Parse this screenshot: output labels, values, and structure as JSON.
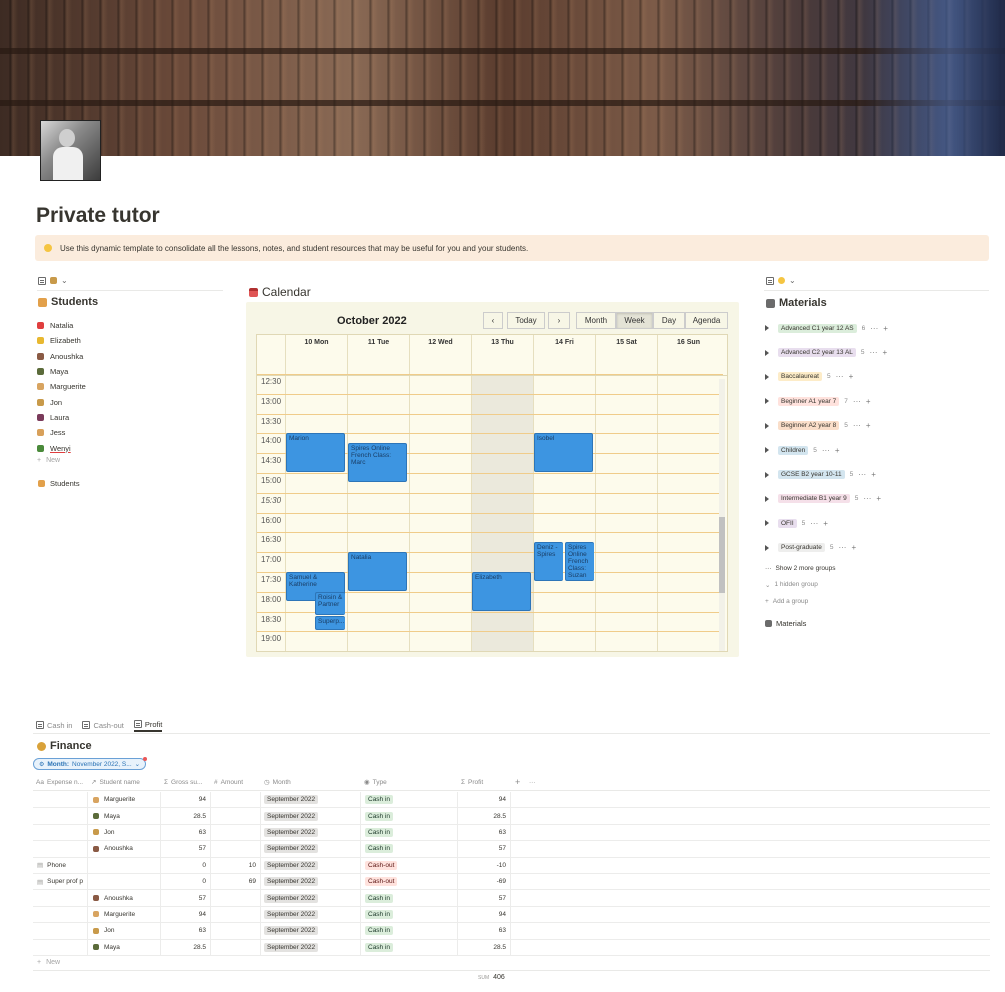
{
  "page": {
    "title": "Private tutor",
    "callout": "Use this dynamic template to consolidate all the lessons, notes, and student resources that may be useful for you and your students."
  },
  "students": {
    "heading": "Students",
    "items": [
      {
        "label": "Natalia",
        "color": "#e03e3e"
      },
      {
        "label": "Elizabeth",
        "color": "#e8b830"
      },
      {
        "label": "Anoushka",
        "color": "#8a5a44"
      },
      {
        "label": "Maya",
        "color": "#5b6b3a"
      },
      {
        "label": "Marguerite",
        "color": "#d8a460"
      },
      {
        "label": "Jon",
        "color": "#c89a4a"
      },
      {
        "label": "Laura",
        "color": "#7a3a5a"
      },
      {
        "label": "Jess",
        "color": "#d8a05a"
      },
      {
        "label": "Wenyi",
        "color": "#4a8a3a"
      }
    ],
    "new_label": "New",
    "footer_link": "Students"
  },
  "calendar": {
    "heading": "Calendar",
    "month_label": "October 2022",
    "nav": {
      "prev": "‹",
      "today": "Today",
      "next": "›"
    },
    "views": [
      "Month",
      "Week",
      "Day",
      "Agenda"
    ],
    "active_view": "Week",
    "days": [
      "10 Mon",
      "11 Tue",
      "12 Wed",
      "13 Thu",
      "14 Fri",
      "15 Sat",
      "16 Sun"
    ],
    "times": [
      "12:30",
      "13:00",
      "13:30",
      "14:00",
      "14:30",
      "15:00",
      "15:30",
      "16:00",
      "16:30",
      "17:00",
      "17:30",
      "18:00",
      "18:30",
      "19:00"
    ],
    "events": [
      {
        "title": "Marion",
        "day": 0,
        "start": 3,
        "span": 2
      },
      {
        "title": "Spires Online French Class: Marc",
        "day": 1,
        "start": 3.5,
        "span": 2
      },
      {
        "title": "Isobel",
        "day": 4,
        "start": 3,
        "span": 2
      },
      {
        "title": "Natalia",
        "day": 1,
        "start": 9,
        "span": 2
      },
      {
        "title": "Deniz - Spires",
        "day": 4,
        "start": 8.5,
        "span": 2,
        "half": "left"
      },
      {
        "title": "Spires Online French Class: Suzan",
        "day": 4,
        "start": 8.5,
        "span": 2,
        "half": "right"
      },
      {
        "title": "Samuel & Katherine",
        "day": 0,
        "start": 10,
        "span": 1.5
      },
      {
        "title": "Elizabeth",
        "day": 3,
        "start": 10,
        "span": 2
      },
      {
        "title": "Roisin & Partner",
        "day": 0,
        "start": 11,
        "span": 1.2,
        "half": "right"
      },
      {
        "title": "Superp...",
        "day": 0,
        "start": 12.2,
        "span": 0.8,
        "half": "right"
      }
    ]
  },
  "materials": {
    "heading": "Materials",
    "groups": [
      {
        "label": "Advanced C1 year 12 AS",
        "count": "6",
        "color": "#dbeddb"
      },
      {
        "label": "Advanced C2 year 13 AL",
        "count": "5",
        "color": "#e8deee"
      },
      {
        "label": "Baccalaureat",
        "count": "5",
        "color": "#fdecc8"
      },
      {
        "label": "Beginner A1 year 7",
        "count": "7",
        "color": "#ffe2dd"
      },
      {
        "label": "Beginner A2 year 8",
        "count": "5",
        "color": "#fadec9"
      },
      {
        "label": "Children",
        "count": "5",
        "color": "#d3e5ef"
      },
      {
        "label": "GCSE B2 year 10-11",
        "count": "5",
        "color": "#d3e5ef"
      },
      {
        "label": "Intermediate B1 year 9",
        "count": "5",
        "color": "#f5e0e9"
      },
      {
        "label": "OFII",
        "count": "5",
        "color": "#e8deee"
      },
      {
        "label": "Post-graduate",
        "count": "5",
        "color": "#eeeeed"
      }
    ],
    "show_more": "Show 2 more groups",
    "hidden_group": "1 hidden group",
    "add_group": "Add a group",
    "footer_link": "Materials"
  },
  "finance": {
    "tabs": [
      "Cash in",
      "Cash-out",
      "Profit"
    ],
    "active_tab": "Profit",
    "heading": "Finance",
    "filter_label": "Month:",
    "filter_value": "November 2022, S...",
    "columns": [
      "Expense n...",
      "Student name",
      "Gross su...",
      "Amount",
      "Month",
      "Type",
      "Profit"
    ],
    "rows": [
      {
        "expense": "",
        "student": "Marguerite",
        "emoji": "#d8a460",
        "gross": "94",
        "amount": "",
        "month": "September 2022",
        "type": "Cash in",
        "profit": "94"
      },
      {
        "expense": "",
        "student": "Maya",
        "emoji": "#5b6b3a",
        "gross": "28.5",
        "amount": "",
        "month": "September 2022",
        "type": "Cash in",
        "profit": "28.5"
      },
      {
        "expense": "",
        "student": "Jon",
        "emoji": "#c89a4a",
        "gross": "63",
        "amount": "",
        "month": "September 2022",
        "type": "Cash in",
        "profit": "63"
      },
      {
        "expense": "",
        "student": "Anoushka",
        "emoji": "#8a5a44",
        "gross": "57",
        "amount": "",
        "month": "September 2022",
        "type": "Cash in",
        "profit": "57"
      },
      {
        "expense": "Phone",
        "student": "",
        "emoji": "",
        "gross": "0",
        "amount": "10",
        "month": "September 2022",
        "type": "Cash-out",
        "profit": "-10"
      },
      {
        "expense": "Super prof p",
        "student": "",
        "emoji": "",
        "gross": "0",
        "amount": "69",
        "month": "September 2022",
        "type": "Cash-out",
        "profit": "-69"
      },
      {
        "expense": "",
        "student": "Anoushka",
        "emoji": "#8a5a44",
        "gross": "57",
        "amount": "",
        "month": "September 2022",
        "type": "Cash in",
        "profit": "57"
      },
      {
        "expense": "",
        "student": "Marguerite",
        "emoji": "#d8a460",
        "gross": "94",
        "amount": "",
        "month": "September 2022",
        "type": "Cash in",
        "profit": "94"
      },
      {
        "expense": "",
        "student": "Jon",
        "emoji": "#c89a4a",
        "gross": "63",
        "amount": "",
        "month": "September 2022",
        "type": "Cash in",
        "profit": "63"
      },
      {
        "expense": "",
        "student": "Maya",
        "emoji": "#5b6b3a",
        "gross": "28.5",
        "amount": "",
        "month": "September 2022",
        "type": "Cash in",
        "profit": "28.5"
      }
    ],
    "new_label": "New",
    "sum_label": "SUM",
    "sum_value": "406"
  }
}
